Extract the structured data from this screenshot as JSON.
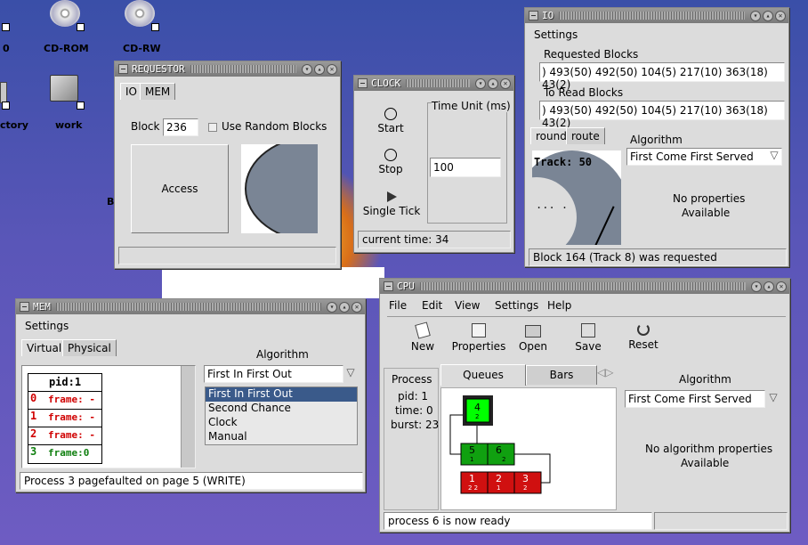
{
  "desktop": {
    "icons": [
      {
        "label": "0"
      },
      {
        "label": "CD-ROM"
      },
      {
        "label": "CD-RW"
      },
      {
        "label": "ctory"
      },
      {
        "label": "work"
      }
    ],
    "stray_b": "B"
  },
  "requestor": {
    "title": "REQUESTOR",
    "tabs": [
      "IO",
      "MEM"
    ],
    "block_label": "Block",
    "block_value": "236",
    "random_label": "Use Random Blocks",
    "access_label": "Access"
  },
  "clock": {
    "title": "CLOCK",
    "start": "Start",
    "stop": "Stop",
    "single": "Single Tick",
    "time_unit_label": "Time Unit (ms)",
    "time_unit_value": "100",
    "status": "current time: 34"
  },
  "io": {
    "title": "IO",
    "menu": "Settings",
    "requested_label": "Requested Blocks",
    "requested_value": ") 493(50) 492(50) 104(5) 217(10) 363(18) 43(2)",
    "toread_label": "To Read Blocks",
    "toread_value": ") 493(50) 492(50) 104(5) 217(10) 363(18) 43(2)",
    "tabs": [
      "round",
      "route"
    ],
    "track": "Track: 50",
    "dots": "...  .",
    "algorithm_label": "Algorithm",
    "algorithm_value": "First Come First Served",
    "no_props": "No properties",
    "available": "Available",
    "status": "Block 164 (Track 8) was requested"
  },
  "mem": {
    "title": "MEM",
    "menu": "Settings",
    "tabs": [
      "Virtual",
      "Physical"
    ],
    "pid": "pid:1",
    "frames": [
      {
        "idx": "0",
        "text": "frame: -",
        "color": "#d00000"
      },
      {
        "idx": "1",
        "text": "frame: -",
        "color": "#d00000"
      },
      {
        "idx": "2",
        "text": "frame: -",
        "color": "#d00000"
      },
      {
        "idx": "3",
        "text": "frame:0",
        "color": "#108010"
      }
    ],
    "algorithm_label": "Algorithm",
    "algorithm_value": "First In First Out",
    "options": [
      "First In First Out",
      "Second Chance",
      "Clock",
      "Manual"
    ],
    "status": "Process 3 pagefaulted on page 5 (WRITE)"
  },
  "cpu": {
    "title": "CPU",
    "menus": [
      "File",
      "Edit",
      "View",
      "Settings",
      "Help"
    ],
    "tools": [
      "New",
      "Properties",
      "Open",
      "Save",
      "Reset"
    ],
    "process_label": "Process",
    "pid": "pid: 1",
    "time": "time: 0",
    "burst": "burst: 23",
    "tabs": [
      "Queues",
      "Bars"
    ],
    "running": "4",
    "running_sub": "2",
    "ready": [
      {
        "n": "6",
        "s": "2"
      }
    ],
    "ready_first": {
      "n": "5",
      "s": "1"
    },
    "blocked": [
      {
        "n": "1",
        "s": "2 2"
      },
      {
        "n": "2",
        "s": "1"
      },
      {
        "n": "3",
        "s": "2"
      }
    ],
    "algorithm_label": "Algorithm",
    "algorithm_value": "First Come First Served",
    "no_props": "No algorithm properties",
    "available": "Available",
    "status": "process 6 is now ready"
  },
  "colors": {
    "green": "#10a010",
    "bright_green": "#00ff00",
    "red": "#d01010",
    "title_gray": "#8a8a8a"
  }
}
